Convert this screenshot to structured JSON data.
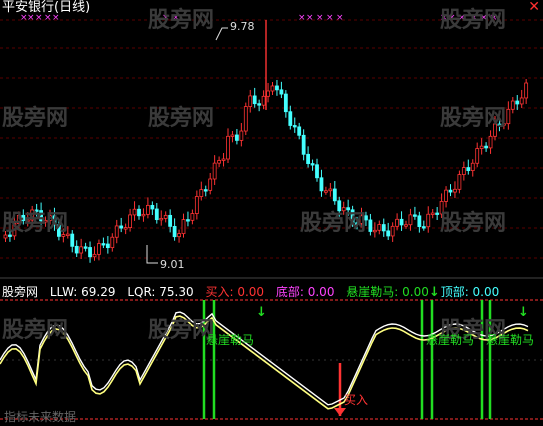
{
  "window": {
    "title": "平安银行(日线)",
    "close_glyph": "✕"
  },
  "watermark": "股旁网",
  "main_panel": {
    "high_marker": "9.78",
    "low_marker": "9.01"
  },
  "indicator_panel": {
    "name": "股旁网",
    "llw": "LLW: 69.29",
    "lqr": "LQR: 75.30",
    "buy": "买入: 0.00",
    "bottom": "底部: 0.00",
    "cliff": "悬崖勒马: 0.00",
    "top": "顶部: 0.00",
    "signal_cliff": "悬崖勒马",
    "signal_buy": "买入",
    "signal_note": "指标未来数据"
  },
  "colors": {
    "up": "#ff3333",
    "down": "#44ffff",
    "line1": "#ffffff",
    "line2": "#ffff80",
    "green": "#22dd22",
    "magenta": "#ff44ff",
    "buy": "#ff3333",
    "llw_label": "#ffffff",
    "buy_label": "#ff3333",
    "bottom_label": "#ff44ff",
    "cliff_label": "#22dd22",
    "top_label": "#44ffff"
  }
}
